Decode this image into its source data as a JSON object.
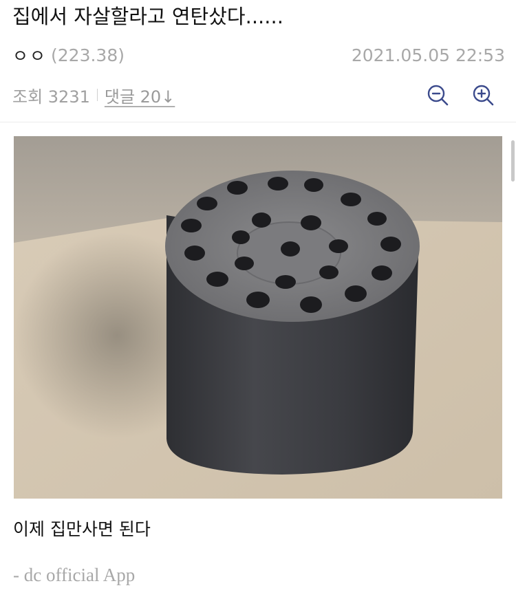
{
  "post": {
    "title": "집에서 자살할라고 연탄샀다......",
    "author_nick": "ㅇㅇ",
    "author_ip": "(223.38)",
    "date": "2021.05.05 22:53",
    "views_label": "조회 3231",
    "comments_label": "댓글 20↓",
    "body": "이제 집만사면 된다",
    "signature": "- dc official App"
  },
  "icons": {
    "zoom_out": "zoom-out-icon",
    "zoom_in": "zoom-in-icon"
  },
  "colors": {
    "icon_accent": "#3b4a8c",
    "meta_gray": "#a8a8a8"
  }
}
